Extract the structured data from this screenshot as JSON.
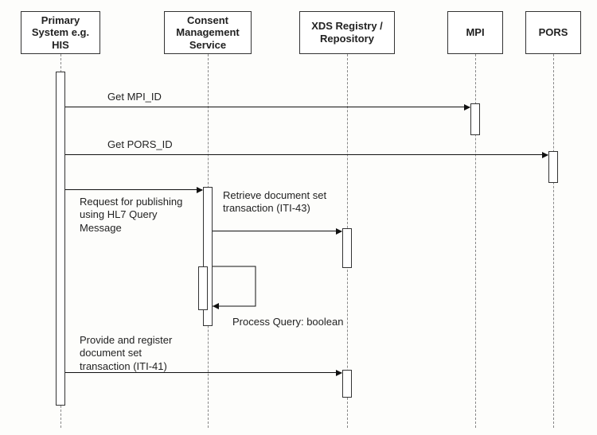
{
  "chart_data": {
    "type": "sequence_diagram",
    "participants": [
      {
        "id": "his",
        "name": "Primary System e.g. HIS"
      },
      {
        "id": "cms",
        "name": "Consent Management Service"
      },
      {
        "id": "xds",
        "name": "XDS Registry / Repository"
      },
      {
        "id": "mpi",
        "name": "MPI"
      },
      {
        "id": "pors",
        "name": "PORS"
      }
    ],
    "messages": [
      {
        "from": "his",
        "to": "mpi",
        "label": "Get MPI_ID"
      },
      {
        "from": "his",
        "to": "pors",
        "label": "Get PORS_ID"
      },
      {
        "from": "his",
        "to": "cms",
        "label": "Request for publishing using HL7 Query Message"
      },
      {
        "from": "cms",
        "to": "xds",
        "label": "Retrieve document set transaction (ITI-43)"
      },
      {
        "from": "cms",
        "to": "cms",
        "label": "Process Query: boolean"
      },
      {
        "from": "his",
        "to": "xds",
        "label": "Provide and register document set transaction (ITI-41)"
      }
    ]
  },
  "actors": {
    "his": "Primary\nSystem e.g.\nHIS",
    "cms": "Consent\nManagement\nService",
    "xds": "XDS Registry /\nRepository",
    "mpi": "MPI",
    "pors": "PORS"
  },
  "labels": {
    "msg_mpi": "Get MPI_ID",
    "msg_pors": "Get PORS_ID",
    "msg_publish": "Request for publishing\nusing HL7 Query\nMessage",
    "msg_retrieve": "Retrieve document set\ntransaction (ITI-43)",
    "msg_process": "Process Query: boolean",
    "msg_provide": "Provide and register\ndocument set\ntransaction (ITI-41)"
  }
}
